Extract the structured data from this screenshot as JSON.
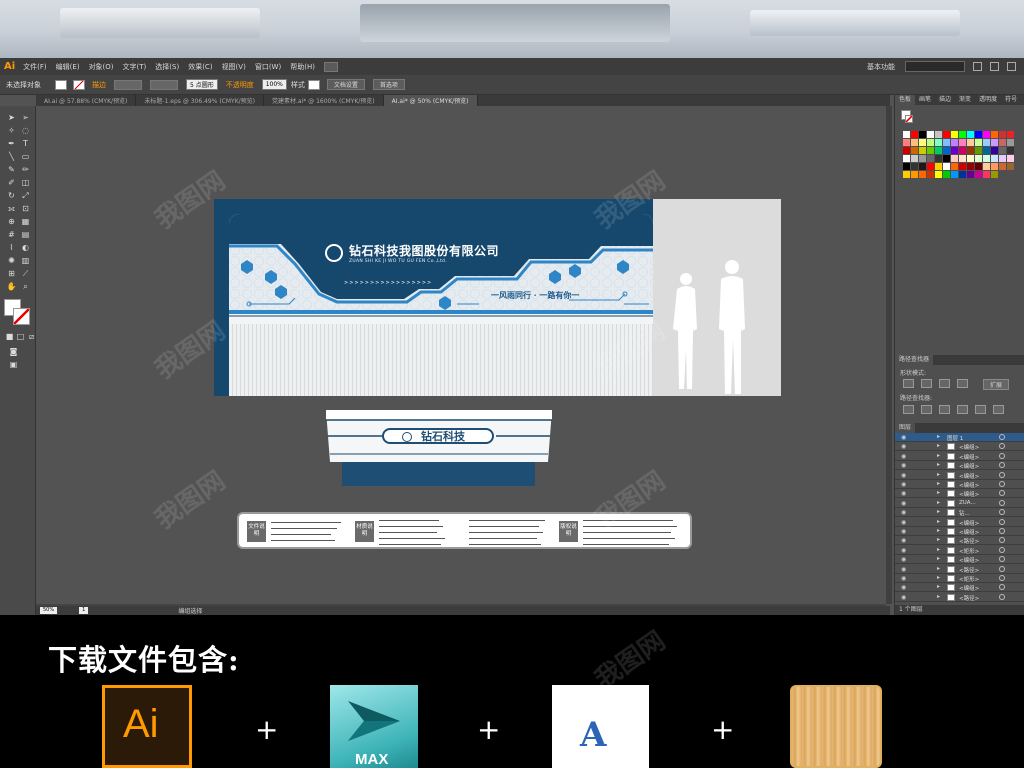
{
  "menubar": {
    "app_logo": "Ai",
    "items": [
      "文件(F)",
      "编辑(E)",
      "对象(O)",
      "文字(T)",
      "选择(S)",
      "效果(C)",
      "视图(V)",
      "窗口(W)",
      "帮助(H)"
    ],
    "workspace": "基本功能"
  },
  "control_bar": {
    "selection_status": "未选择对象",
    "stroke_label": "描边",
    "brush_value": "5 点圆形",
    "opacity_label": "不透明度",
    "opacity_value": "100%",
    "style_label": "样式",
    "doc_setup_button": "文档设置",
    "preferences_button": "首选项"
  },
  "tabs": [
    {
      "label": "AI.ai @ 57.88% (CMYK/预览)",
      "active": false
    },
    {
      "label": "未标题-1.eps @ 306.49% (CMYK/预览)",
      "active": false
    },
    {
      "label": "党建素材.ai* @ 1600% (CMYK/预览)",
      "active": false
    },
    {
      "label": "AI.ai* @ 50% (CMYK/预览)",
      "active": true
    }
  ],
  "artwork": {
    "company_name": "钻石科技我图股份有限公司",
    "company_pinyin": "ZUAN SHI KE JI WO TU GU FEN Co.,Ltd.",
    "arrows": ">>>>>>>>>>>>>>>>>",
    "slogan": "一风雨同行 · 一路有你一",
    "desk_label": "钻石科技",
    "spec_tags": [
      "文件说明",
      "材质说明",
      "版权说明"
    ]
  },
  "status_bar": {
    "zoom": "50%",
    "page": "1",
    "tool_status": "编组选择"
  },
  "panels": {
    "swatch_tabs": [
      "色板",
      "画笔",
      "描边",
      "渐变",
      "透明度",
      "符号"
    ],
    "pathfinder_tab": "路径查找器",
    "shape_modes_label": "形状模式:",
    "expand_button": "扩展",
    "pathfinder_label": "路径查找器:",
    "layers_tab": "图层",
    "layers_footer": "1 个图层",
    "layers": [
      {
        "name": "图层 1",
        "top": true
      },
      {
        "name": "<编组>"
      },
      {
        "name": "<编组>"
      },
      {
        "name": "<编组>"
      },
      {
        "name": "<编组>"
      },
      {
        "name": "<编组>"
      },
      {
        "name": "<编组>"
      },
      {
        "name": "ZUA..."
      },
      {
        "name": "钻..."
      },
      {
        "name": "<编组>"
      },
      {
        "name": "<编组>"
      },
      {
        "name": "<路径>"
      },
      {
        "name": "<矩形>"
      },
      {
        "name": "<编组>"
      },
      {
        "name": "<路径>"
      },
      {
        "name": "<矩形>"
      },
      {
        "name": "<编组>"
      },
      {
        "name": "<路径>"
      }
    ]
  },
  "swatch_colors": [
    "#ffffff",
    "#ff0000",
    "#000000",
    "#ffffff",
    "#c4c4c4",
    "#ff0000",
    "#ffff00",
    "#00ff00",
    "#00ffff",
    "#0000ff",
    "#ff00ff",
    "#ff6600",
    "#cc3333",
    "#ee2222",
    "#ff7f7f",
    "#ffbf7f",
    "#ffff7f",
    "#bfff7f",
    "#7fffbf",
    "#7fbfff",
    "#bf7fff",
    "#ff7fbf",
    "#ffcc99",
    "#ccff99",
    "#99ccff",
    "#cc99ff",
    "#cc6666",
    "#999999",
    "#cc0000",
    "#cc6600",
    "#cccc00",
    "#66cc00",
    "#00cc66",
    "#0066cc",
    "#6600cc",
    "#cc0066",
    "#993300",
    "#669900",
    "#006699",
    "#330099",
    "#666666",
    "#333333",
    "#ffffff",
    "#cccccc",
    "#999999",
    "#666666",
    "#333333",
    "#000000",
    "#ffcccc",
    "#ffe5cc",
    "#ffffcc",
    "#e5ffcc",
    "#ccffe5",
    "#cce5ff",
    "#e5ccff",
    "#ffcce5",
    "#000000",
    "#333333",
    "#1a1a1a",
    "#ff0000",
    "#ffcc00",
    "#ffffff",
    "#ff6600",
    "#cc0000",
    "#990000",
    "#660000",
    "#ffcc99",
    "#ff9966",
    "#cc6633",
    "#996633",
    "#ffcc00",
    "#ff9900",
    "#ff6600",
    "#cc3300",
    "#ffff00",
    "#00cc00",
    "#0099ff",
    "#003399",
    "#660099",
    "#cc0099",
    "#ff3366",
    "#999900"
  ],
  "promo": {
    "title": "下载文件包含:",
    "plus": "+",
    "ai_icon": "Ai",
    "max_icon": "MAX",
    "font_icon": "A"
  },
  "watermark": "我图网"
}
